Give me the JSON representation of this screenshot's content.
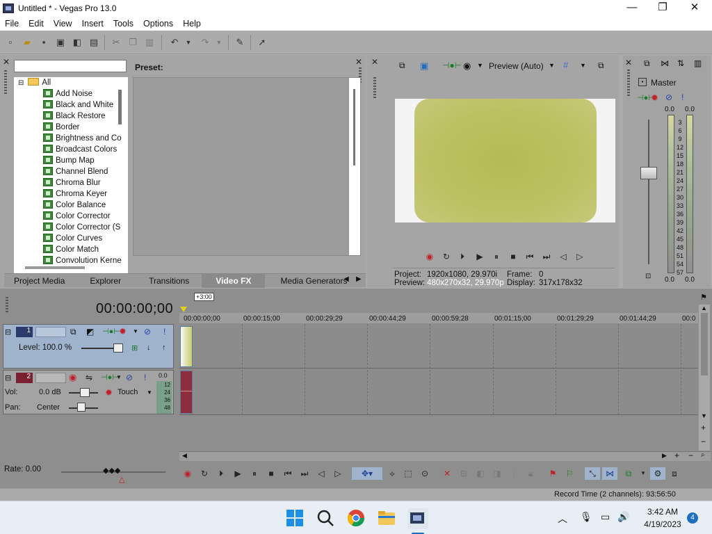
{
  "window": {
    "title": "Untitled * - Vegas Pro 13.0",
    "min_glyph": "—",
    "max_glyph": "❐",
    "close_glyph": "✕"
  },
  "menu": [
    "File",
    "Edit",
    "View",
    "Insert",
    "Tools",
    "Options",
    "Help"
  ],
  "fx_panel": {
    "search_value": "",
    "preset_label": "Preset:",
    "tree_root": "All",
    "tree_toggle": "⊟",
    "items": [
      "Add Noise",
      "Black and White",
      "Black Restore",
      "Border",
      "Brightness and Co",
      "Broadcast Colors",
      "Bump Map",
      "Channel Blend",
      "Chroma Blur",
      "Chroma Keyer",
      "Color Balance",
      "Color Corrector",
      "Color Corrector (S",
      "Color Curves",
      "Color Match",
      "Convolution Kerne"
    ]
  },
  "tabs": [
    "Project Media",
    "Explorer",
    "Transitions",
    "Video FX",
    "Media Generators"
  ],
  "active_tab": "Video FX",
  "preview": {
    "mode": "Preview (Auto)",
    "project_label": "Project:",
    "project_value": "1920x1080, 29.970i",
    "preview_label": "Preview:",
    "preview_value": "480x270x32, 29.970p",
    "frame_label": "Frame:",
    "frame_value": "0",
    "display_label": "Display:",
    "display_value": "317x178x32"
  },
  "mixer": {
    "title": "Master",
    "left_peak": "0.0",
    "right_peak": "0.0",
    "left_bottom": "0.0",
    "right_bottom": "0.0",
    "scale": [
      "3",
      "6",
      "9",
      "12",
      "15",
      "18",
      "21",
      "24",
      "27",
      "30",
      "33",
      "36",
      "39",
      "42",
      "45",
      "48",
      "51",
      "54",
      "57"
    ]
  },
  "timeline": {
    "timecode": "00:00:00;00",
    "marker": "+3:00",
    "ruler": [
      "00:00:00;00",
      "00:00:15;00",
      "00:00:29;29",
      "00:00:44;29",
      "00:00:59;28",
      "00:01:15;00",
      "00:01:29;29",
      "00:01:44;29",
      "00:0"
    ],
    "video_track": {
      "number": "1",
      "level_label": "Level: 100.0 %"
    },
    "audio_track": {
      "number": "2",
      "vol_label": "Vol:",
      "vol_value": "0.0 dB",
      "pan_label": "Pan:",
      "pan_value": "Center",
      "automation": "Touch",
      "peak": "0.0",
      "meter_ticks": [
        "12",
        "24",
        "36",
        "48"
      ]
    },
    "rate": "Rate: 0.00"
  },
  "status": {
    "record_time": "Record Time (2 channels): 93:56:50"
  },
  "taskbar": {
    "time": "3:42 AM",
    "date": "4/19/2023",
    "badge": "4",
    "chevron": "︿",
    "mic_glyph": "🎙",
    "net_glyph": "▭",
    "vol_glyph": "🔊"
  }
}
